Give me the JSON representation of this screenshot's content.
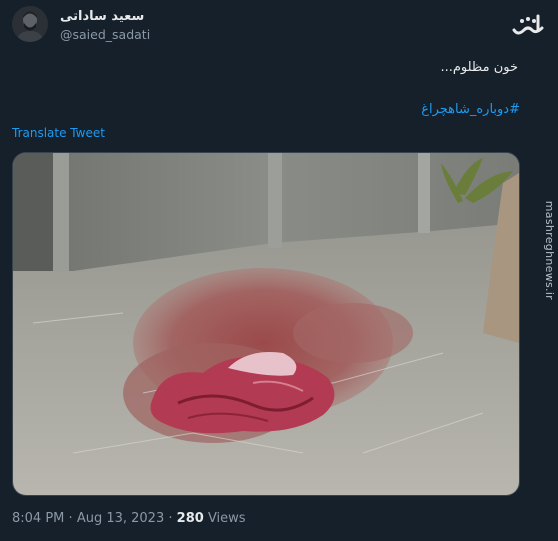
{
  "author": {
    "display_name": "سعید ساداتی",
    "handle": "@saied_sadati"
  },
  "watermark": {
    "logo_icon": "mashregh-logo-icon",
    "site": "mashreghnews.ir"
  },
  "tweet": {
    "text": "خون مظلوم...",
    "hashtag": "#دوباره_شاهچراغ",
    "translate_label": "Translate Tweet"
  },
  "media": {
    "description_icon": "photo-icon"
  },
  "footer": {
    "time": "8:04 PM",
    "separator": "·",
    "date": "Aug 13, 2023",
    "views_count": "280",
    "views_label": "Views"
  },
  "colors": {
    "background": "#15202b",
    "accent": "#1d9bf0",
    "muted": "#8b98a5"
  }
}
